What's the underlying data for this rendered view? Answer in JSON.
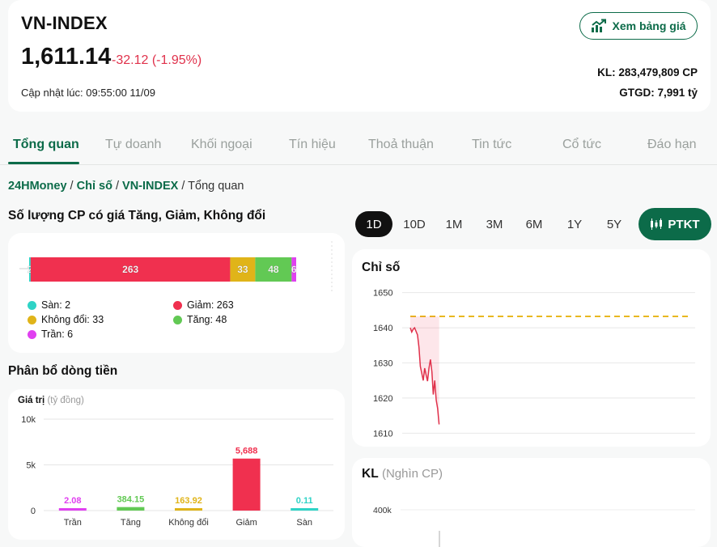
{
  "header": {
    "title": "VN-INDEX",
    "price": "1,611.14",
    "change": "-32.12 (-1.95%)",
    "updated": "Cập nhật lúc: 09:55:00 11/09",
    "board_button": "Xem bảng giá",
    "kl": "KL: 283,479,809 CP",
    "gtgd": "GTGD: 7,991 tỷ"
  },
  "tabs": [
    "Tổng quan",
    "Tự doanh",
    "Khối ngoại",
    "Tín hiệu",
    "Thoả thuận",
    "Tin tức",
    "Cổ tức",
    "Đáo hạn"
  ],
  "breadcrumb": {
    "home": "24HMoney",
    "sep": " / ",
    "section": "Chỉ số",
    "index": "VN-INDEX",
    "page": "Tổng quan"
  },
  "distribution": {
    "title": "Số lượng CP có giá Tăng, Giảm, Không đổi",
    "segments": [
      {
        "label": "Sàn",
        "value": 2,
        "color": "#2fd3c6"
      },
      {
        "label": "Giảm",
        "value": 263,
        "color": "#f0304f"
      },
      {
        "label": "Không đổi",
        "value": 33,
        "color": "#e0b419"
      },
      {
        "label": "Tăng",
        "value": 48,
        "color": "#62c954"
      },
      {
        "label": "Trần",
        "value": 6,
        "color": "#e040f0"
      }
    ],
    "legend": [
      {
        "text": "Sàn: 2",
        "color": "#2fd3c6"
      },
      {
        "text": "Giảm: 263",
        "color": "#f0304f"
      },
      {
        "text": "Không đổi: 33",
        "color": "#e0b419"
      },
      {
        "text": "Tăng: 48",
        "color": "#62c954"
      },
      {
        "text": "Trần: 6",
        "color": "#e040f0"
      }
    ]
  },
  "flow": {
    "title": "Phân bổ dòng tiền",
    "axis_title": "Giá trị",
    "axis_unit": "(tỷ đồng)"
  },
  "ranges": [
    "1D",
    "10D",
    "1M",
    "3M",
    "6M",
    "1Y",
    "5Y"
  ],
  "ptkt_button": "PTKT",
  "index_chart": {
    "title": "Chỉ số"
  },
  "kl_chart": {
    "title": "KL",
    "unit": "(Nghìn CP)",
    "tick": "400k"
  },
  "chart_data": [
    {
      "type": "bar",
      "title": "Phân bổ dòng tiền",
      "ylabel": "Giá trị (tỷ đồng)",
      "categories": [
        "Trần",
        "Tăng",
        "Không đổi",
        "Giảm",
        "Sàn"
      ],
      "values": [
        2.08,
        384.15,
        163.92,
        5688,
        0.11
      ],
      "value_labels": [
        "2.08",
        "384.15",
        "163.92",
        "5,688",
        "0.11"
      ],
      "colors": [
        "#e040f0",
        "#62c954",
        "#e0b419",
        "#f0304f",
        "#2fd3c6"
      ],
      "ylim": [
        0,
        10000
      ],
      "yticks": [
        0,
        5000,
        10000
      ],
      "ytick_labels": [
        "0",
        "5k",
        "10k"
      ]
    },
    {
      "type": "line",
      "title": "Chỉ số",
      "reference": 1643.26,
      "ylim": [
        1608,
        1652
      ],
      "yticks": [
        1610,
        1620,
        1630,
        1640,
        1650
      ],
      "x": [
        0,
        1,
        2,
        3,
        4,
        5,
        6,
        7,
        8,
        9,
        10,
        11,
        12,
        13,
        14,
        15,
        16,
        17,
        18,
        19,
        20
      ],
      "values": [
        1640.0,
        1638.8,
        1639.6,
        1640.0,
        1639.0,
        1638.0,
        1634.5,
        1629.0,
        1627.0,
        1625.0,
        1628.5,
        1626.5,
        1624.8,
        1628.5,
        1631.0,
        1627.5,
        1621.0,
        1625.0,
        1619.5,
        1617.0,
        1612.5
      ],
      "x_total": 100
    }
  ]
}
